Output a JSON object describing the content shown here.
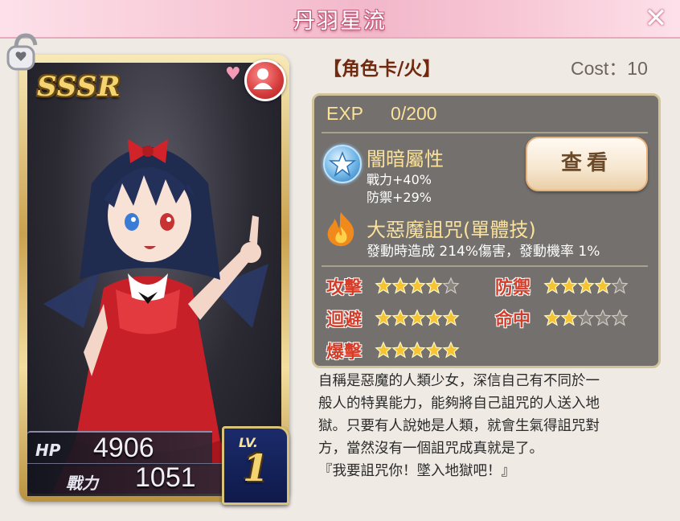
{
  "window": {
    "title": "丹羽星流",
    "close_label": "✕"
  },
  "card": {
    "rarity": "SSSR",
    "hp_label": "HP",
    "hp_value": "4906",
    "power_label": "戰力",
    "power_value": "1051",
    "level_label": "LV.",
    "level_value": "1"
  },
  "info": {
    "type": "【角色卡/火】",
    "cost": "Cost：10",
    "exp_label": "EXP",
    "exp_value": "0/200",
    "attribute": {
      "name": "闇暗屬性",
      "bonus_1": "戰力+40%",
      "bonus_2": "防禦+29%",
      "icon": "star-badge-icon"
    },
    "view_button": "查看",
    "skill": {
      "name": "大惡魔詛咒(單體技)",
      "desc": "發動時造成 214%傷害，發動機率 1%",
      "icon": "fire-icon"
    },
    "stats": [
      {
        "label": "攻擊",
        "stars": 4,
        "max": 5
      },
      {
        "label": "防禦",
        "stars": 4,
        "max": 5
      },
      {
        "label": "迴避",
        "stars": 5,
        "max": 5
      },
      {
        "label": "命中",
        "stars": 2,
        "max": 5
      },
      {
        "label": "爆擊",
        "stars": 5,
        "max": 5
      }
    ],
    "description_lines": [
      "自稱是惡魔的人類少女，深信自己有不同於一",
      "般人的特異能力，能夠將自己詛咒的人送入地",
      "獄。只要有人說她是人類，就會生氣得詛咒對",
      "方，當然沒有一個詛咒成真就是了。",
      "『我要詛咒你！墜入地獄吧！』"
    ]
  },
  "colors": {
    "header_pink": "#f2b8cb",
    "panel_gray": "#625f5c",
    "highlight_yellow": "#fbe19a",
    "stat_red": "#d23e2a",
    "star_gold": "#f6c431"
  }
}
